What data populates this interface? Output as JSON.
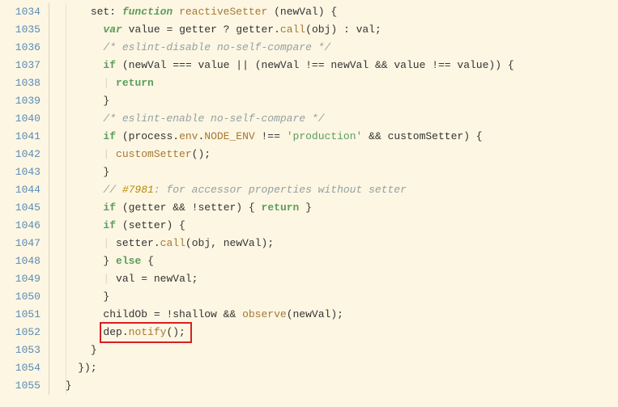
{
  "lines": {
    "l1034n": "1034",
    "l1035n": "1035",
    "l1036n": "1036",
    "l1037n": "1037",
    "l1038n": "1038",
    "l1039n": "1039",
    "l1040n": "1040",
    "l1041n": "1041",
    "l1042n": "1042",
    "l1043n": "1043",
    "l1044n": "1044",
    "l1045n": "1045",
    "l1046n": "1046",
    "l1047n": "1047",
    "l1048n": "1048",
    "l1049n": "1049",
    "l1050n": "1050",
    "l1051n": "1051",
    "l1052n": "1052",
    "l1053n": "1053",
    "l1054n": "1054",
    "l1055n": "1055"
  },
  "t": {
    "set": "set",
    "colon": ": ",
    "function": "function",
    "space": " ",
    "reactiveSetter": "reactiveSetter",
    "sp1": " ",
    "lpar": "(",
    "newVal": "newVal",
    "rpar": ")",
    "sp2": " ",
    "var": "var",
    "value": "value",
    "eq": " = ",
    "getter": "getter",
    "q": " ? ",
    "dot": ".",
    "call": "call",
    "obj": "obj",
    "colon2": " : ",
    "val": "val",
    "semi": ";",
    "cmt1": "/* eslint-disable no-self-compare */",
    "if": "if",
    "sp3": " (",
    "tripleeq": " === ",
    "or": " || ",
    "neq": " !== ",
    "and": " && ",
    "rpar2": ")) {",
    "rpar3": ") {",
    "return": "return",
    "cmt2": "/* eslint-enable no-self-compare */",
    "process": "process",
    "env": "env",
    "NODE_ENV": "NODE_ENV",
    "production": "'production'",
    "customSetter": "customSetter",
    "cs_call": "();",
    "cmt3a": "// ",
    "cmt3b": "#7981",
    "cmt3c": ": for accessor properties without setter",
    "setter": "setter",
    "not": "!",
    "returnsp": "return",
    "comma": ", ",
    "else": "else",
    "childOb": "childOb",
    "shallow": "shallow",
    "observe": "observe",
    "dep": "dep",
    "notify": "notify",
    "cbrace": "}",
    "obrace": "{",
    "rparen_semi": ");",
    "rparen": ")",
    "semi2": ";",
    "rparen_ob": ") {"
  },
  "indent": {
    "i3": "      ",
    "i4": "        ",
    "i5": "          ",
    "i6": "            "
  },
  "guide": "|"
}
